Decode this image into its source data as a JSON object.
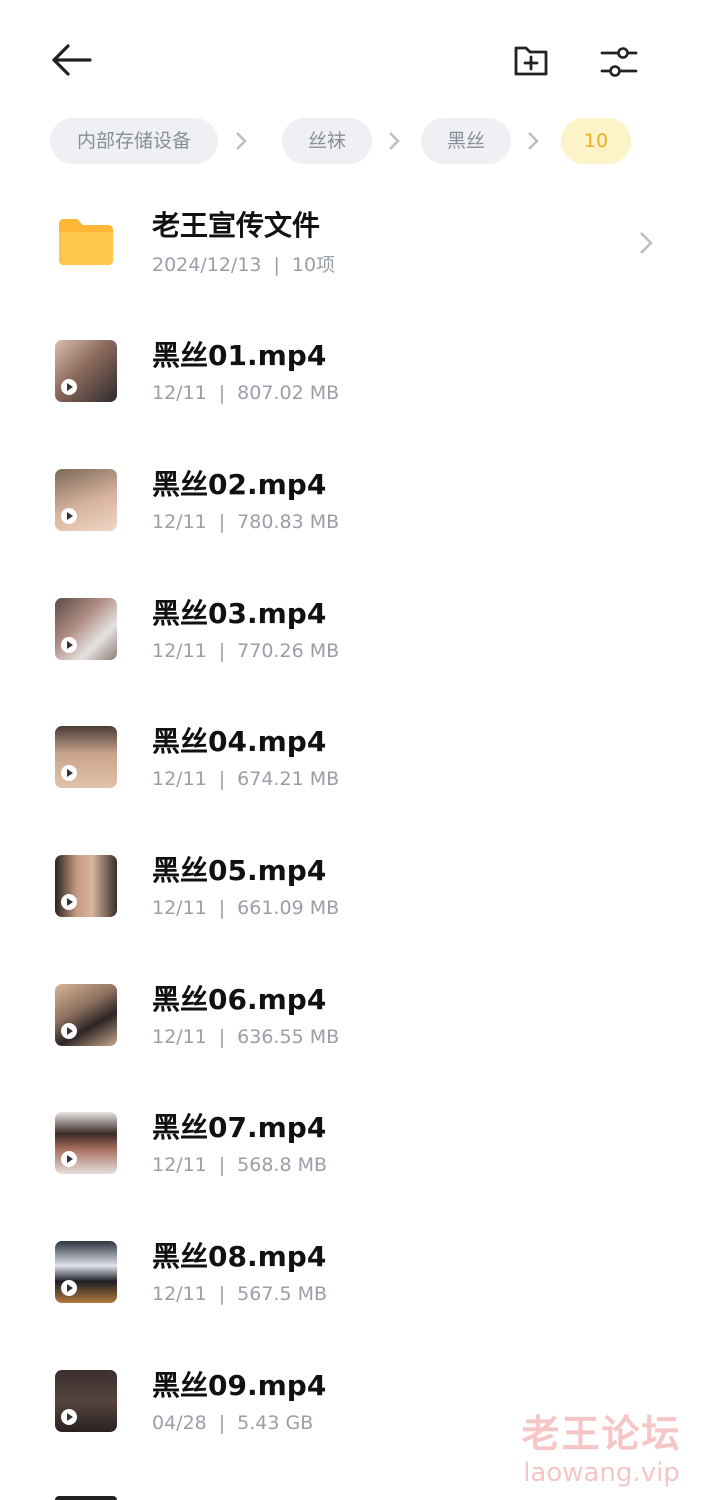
{
  "header": {
    "back_icon": "arrow-left-icon",
    "new_folder_icon": "folder-plus-icon",
    "filter_icon": "sliders-icon"
  },
  "breadcrumb": [
    {
      "label": "内部存储设备",
      "active": false
    },
    {
      "label": "丝袜",
      "active": false
    },
    {
      "label": "黑丝",
      "active": false
    },
    {
      "label": "10",
      "active": true
    }
  ],
  "folder": {
    "name": "老王宣传文件",
    "date": "2024/12/13",
    "count": "10项",
    "icon": "folder-icon",
    "color": "#ffb634"
  },
  "files": [
    {
      "name": "黑丝01.mp4",
      "date": "12/11",
      "size": "807.02 MB"
    },
    {
      "name": "黑丝02.mp4",
      "date": "12/11",
      "size": "780.83 MB"
    },
    {
      "name": "黑丝03.mp4",
      "date": "12/11",
      "size": "770.26 MB"
    },
    {
      "name": "黑丝04.mp4",
      "date": "12/11",
      "size": "674.21 MB"
    },
    {
      "name": "黑丝05.mp4",
      "date": "12/11",
      "size": "661.09 MB"
    },
    {
      "name": "黑丝06.mp4",
      "date": "12/11",
      "size": "636.55 MB"
    },
    {
      "name": "黑丝07.mp4",
      "date": "12/11",
      "size": "568.8 MB"
    },
    {
      "name": "黑丝08.mp4",
      "date": "12/11",
      "size": "567.5 MB"
    },
    {
      "name": "黑丝09.mp4",
      "date": "04/28",
      "size": "5.43 GB"
    }
  ],
  "watermark": {
    "title": "老王论坛",
    "site": "laowang.vip"
  },
  "colors": {
    "accent": "#e8b01a",
    "chip_bg": "#eff0f3",
    "active_chip_bg": "#fdf3c8",
    "muted_text": "#9a9ea6"
  }
}
